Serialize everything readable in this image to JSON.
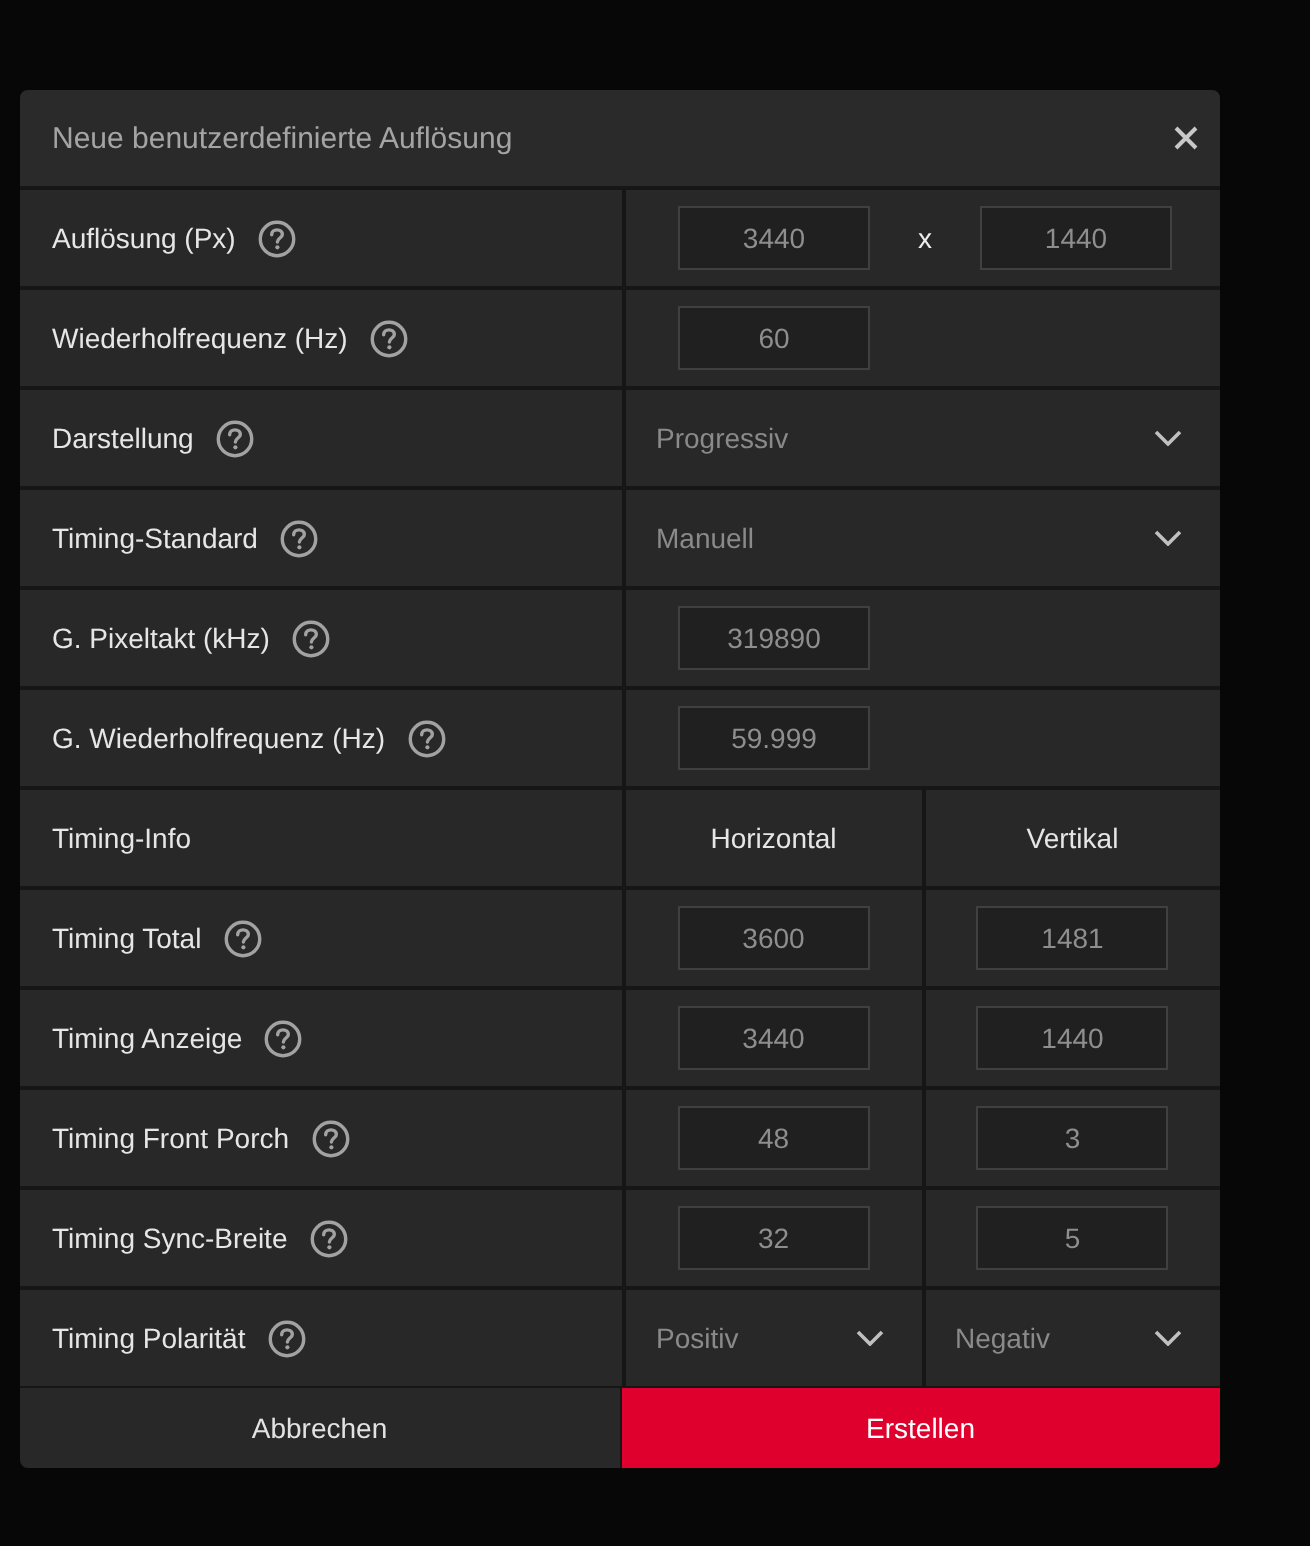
{
  "dialog": {
    "title": "Neue benutzerdefinierte Auflösung"
  },
  "rows": [
    {
      "kind": "pair",
      "label": "Auflösung (Px)",
      "help": true,
      "values": [
        "3440",
        "1440"
      ],
      "separator": "x"
    },
    {
      "kind": "input",
      "label": "Wiederholfrequenz (Hz)",
      "help": true,
      "values": [
        "60"
      ]
    },
    {
      "kind": "select",
      "label": "Darstellung",
      "help": true,
      "values": [
        "Progressiv"
      ]
    },
    {
      "kind": "select",
      "label": "Timing-Standard",
      "help": true,
      "values": [
        "Manuell"
      ]
    },
    {
      "kind": "input",
      "label": "G. Pixeltakt (kHz)",
      "help": true,
      "values": [
        "319890"
      ]
    },
    {
      "kind": "input",
      "label": "G. Wiederholfrequenz (Hz)",
      "help": true,
      "values": [
        "59.999"
      ]
    },
    {
      "kind": "header",
      "label": "Timing-Info",
      "help": false,
      "values": [
        "Horizontal",
        "Vertikal"
      ]
    },
    {
      "kind": "split_input",
      "label": "Timing Total",
      "help": true,
      "values": [
        "3600",
        "1481"
      ]
    },
    {
      "kind": "split_input",
      "label": "Timing Anzeige",
      "help": true,
      "values": [
        "3440",
        "1440"
      ]
    },
    {
      "kind": "split_input",
      "label": "Timing Front Porch",
      "help": true,
      "values": [
        "48",
        "3"
      ]
    },
    {
      "kind": "split_input",
      "label": "Timing Sync-Breite",
      "help": true,
      "values": [
        "32",
        "5"
      ]
    },
    {
      "kind": "split_select",
      "label": "Timing Polarität",
      "help": true,
      "values": [
        "Positiv",
        "Negativ"
      ]
    }
  ],
  "buttons": [
    {
      "kind": "secondary",
      "label": "Abbrechen"
    },
    {
      "kind": "primary",
      "label": "Erstellen"
    }
  ]
}
